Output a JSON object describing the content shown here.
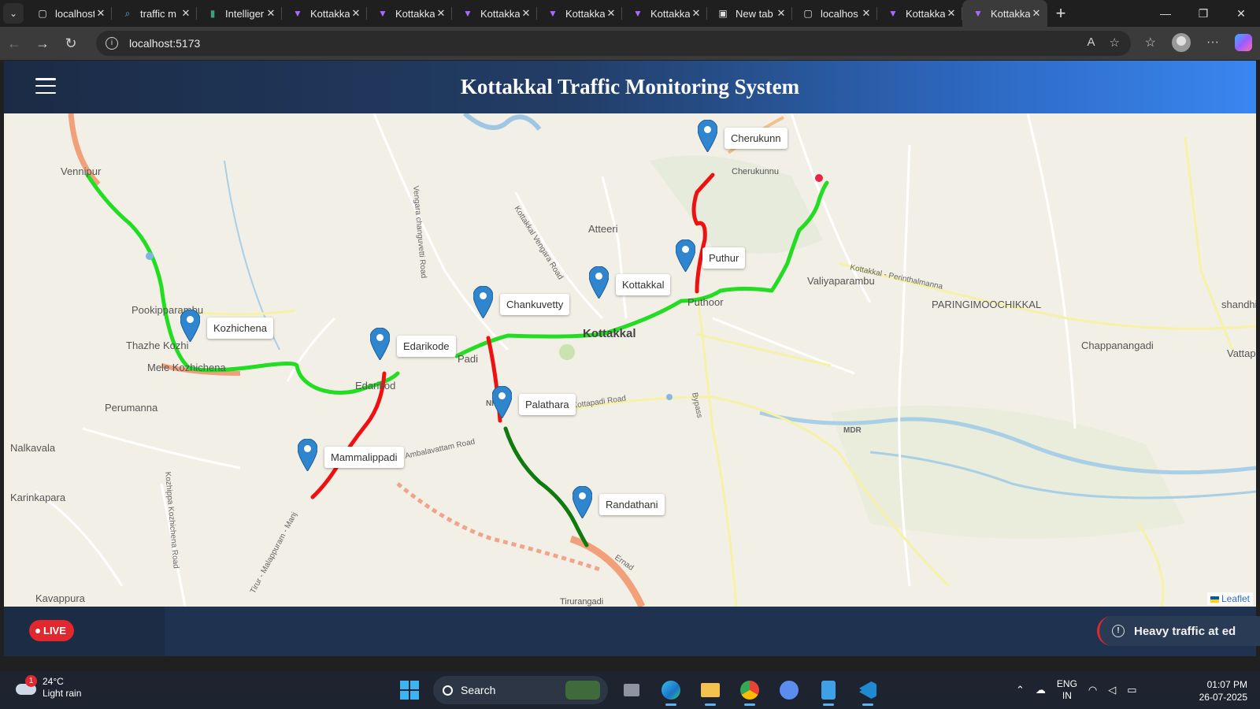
{
  "browser": {
    "tabs": [
      {
        "title": "localhost:",
        "icon": "page-icon"
      },
      {
        "title": "traffic m",
        "icon": "search-icon"
      },
      {
        "title": "Intelliger",
        "icon": "ieee-icon"
      },
      {
        "title": "Kottakka",
        "icon": "vite-icon"
      },
      {
        "title": "Kottakka",
        "icon": "vite-icon"
      },
      {
        "title": "Kottakka",
        "icon": "vite-icon"
      },
      {
        "title": "Kottakka",
        "icon": "vite-icon"
      },
      {
        "title": "Kottakka",
        "icon": "vite-icon"
      },
      {
        "title": "New tab",
        "icon": "newtab-icon"
      },
      {
        "title": "localhos",
        "icon": "page-icon"
      },
      {
        "title": "Kottakka",
        "icon": "vite-icon"
      },
      {
        "title": "Kottakka",
        "icon": "vite-icon"
      }
    ],
    "active_tab_index": 11,
    "url": "localhost:5173"
  },
  "app": {
    "title": "Kottakkal Traffic Monitoring System",
    "live_label": "LIVE",
    "alert_text": "Heavy traffic at ed",
    "attribution": "Leaflet"
  },
  "map": {
    "markers": [
      {
        "label": "Cherukunn"
      },
      {
        "label": "Puthur"
      },
      {
        "label": "Kottakkal"
      },
      {
        "label": "Chankuvetty"
      },
      {
        "label": "Edarikode"
      },
      {
        "label": "Kozhichena"
      },
      {
        "label": "Palathara"
      },
      {
        "label": "Mammalippadi"
      },
      {
        "label": "Randathani"
      }
    ],
    "place_names": [
      {
        "text": "Vennipur"
      },
      {
        "text": "Pookipparambu"
      },
      {
        "text": "Thazhe Kozhi"
      },
      {
        "text": "Mele Kozhichena"
      },
      {
        "text": "Perumanna"
      },
      {
        "text": "Nalkavala"
      },
      {
        "text": "Karinkapara"
      },
      {
        "text": "Kavappura"
      },
      {
        "text": "Atteeri"
      },
      {
        "text": "Kottakkal"
      },
      {
        "text": "Valiyaparambu"
      },
      {
        "text": "PARINGIMOOCHIKKAL"
      },
      {
        "text": "Chappanangadi"
      },
      {
        "text": "shandhi"
      },
      {
        "text": "Vattap"
      },
      {
        "text": "Cherukunnu"
      },
      {
        "text": "Edarikod"
      },
      {
        "text": "Padi"
      },
      {
        "text": "Puthoor"
      },
      {
        "text": "Tirurangadi"
      }
    ],
    "road_names": [
      {
        "text": "Kottakkal Vengara Road"
      },
      {
        "text": "Vengara changuvetti Road"
      },
      {
        "text": "Kottakkal - Perinthalmanna"
      },
      {
        "text": "Kottapadi Road"
      },
      {
        "text": "Ambalavattam Road"
      },
      {
        "text": "Bypass"
      },
      {
        "text": "Kozhippa Kozhichena Road"
      },
      {
        "text": "Tirur - Malappuram - Manj"
      },
      {
        "text": "Ernad"
      },
      {
        "text": "MDR"
      },
      {
        "text": "NH 66"
      }
    ],
    "traffic_colors": {
      "free": "#22dd22",
      "heavy": "#ee1111",
      "moderate": "#0f7a0f"
    }
  },
  "taskbar": {
    "weather_badge": "1",
    "temperature": "24°C",
    "condition": "Light rain",
    "search_label": "Search",
    "lang_line1": "ENG",
    "lang_line2": "IN",
    "time": "01:07 PM",
    "date": "26-07-2025"
  }
}
